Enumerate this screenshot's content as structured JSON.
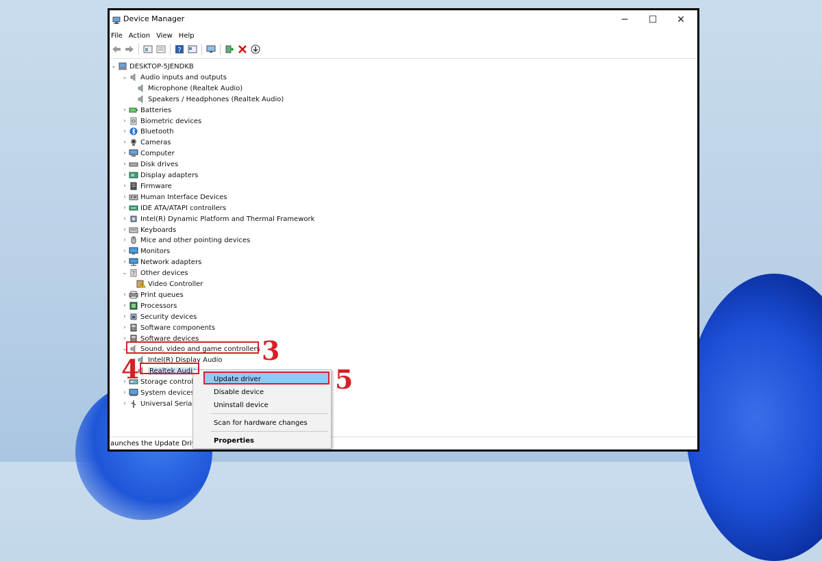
{
  "window": {
    "title": "Device Manager",
    "controls": {
      "minimize": "─",
      "maximize": "☐",
      "close": "✕"
    }
  },
  "menu": [
    "File",
    "Action",
    "View",
    "Help"
  ],
  "tree": {
    "root": "DESKTOP-5JENDKB",
    "items": [
      {
        "label": "Audio inputs and outputs",
        "expanded": true,
        "icon": "speaker-icon"
      },
      {
        "label": "Microphone (Realtek Audio)",
        "child": true,
        "icon": "speaker-icon"
      },
      {
        "label": "Speakers / Headphones (Realtek Audio)",
        "child": true,
        "icon": "speaker-icon"
      },
      {
        "label": "Batteries",
        "icon": "battery-icon"
      },
      {
        "label": "Biometric devices",
        "icon": "biometric-icon"
      },
      {
        "label": "Bluetooth",
        "icon": "bluetooth-icon"
      },
      {
        "label": "Cameras",
        "icon": "camera-icon"
      },
      {
        "label": "Computer",
        "icon": "computer-icon"
      },
      {
        "label": "Disk drives",
        "icon": "disk-icon"
      },
      {
        "label": "Display adapters",
        "icon": "display-adapter-icon"
      },
      {
        "label": "Firmware",
        "icon": "firmware-icon"
      },
      {
        "label": "Human Interface Devices",
        "icon": "hid-icon"
      },
      {
        "label": "IDE ATA/ATAPI controllers",
        "icon": "ide-icon"
      },
      {
        "label": "Intel(R) Dynamic Platform and Thermal Framework",
        "icon": "chip-icon"
      },
      {
        "label": "Keyboards",
        "icon": "keyboard-icon"
      },
      {
        "label": "Mice and other pointing devices",
        "icon": "mouse-icon"
      },
      {
        "label": "Monitors",
        "icon": "monitor-icon"
      },
      {
        "label": "Network adapters",
        "icon": "network-icon"
      },
      {
        "label": "Other devices",
        "expanded": true,
        "icon": "unknown-device-icon"
      },
      {
        "label": "Video Controller",
        "child": true,
        "icon": "warning-device-icon"
      },
      {
        "label": "Print queues",
        "icon": "printer-icon"
      },
      {
        "label": "Processors",
        "icon": "processor-icon"
      },
      {
        "label": "Security devices",
        "icon": "security-icon"
      },
      {
        "label": "Software components",
        "icon": "software-icon"
      },
      {
        "label": "Software devices",
        "icon": "software-icon"
      },
      {
        "label": "Sound, video and game controllers",
        "expanded": true,
        "icon": "speaker-icon"
      },
      {
        "label": "Intel(R) Display Audio",
        "child": true,
        "icon": "speaker-icon"
      },
      {
        "label": "Realtek Audio",
        "child": true,
        "selected": true,
        "icon": "speaker-icon"
      },
      {
        "label": "Storage controll",
        "icon": "storage-icon"
      },
      {
        "label": "System devices",
        "icon": "system-icon"
      },
      {
        "label": "Universal Serial",
        "icon": "usb-icon"
      }
    ]
  },
  "context_menu": {
    "items": [
      "Update driver",
      "Disable device",
      "Uninstall device",
      "Scan for hardware changes",
      "Properties"
    ]
  },
  "status_text": "aunches the Update Driver",
  "annotations": {
    "step3": "3",
    "step4": "4",
    "step5": "5"
  },
  "colors": {
    "highlight": "#d81f26",
    "selection": "#cce4f7",
    "menu_highlight": "#91c9f7"
  }
}
